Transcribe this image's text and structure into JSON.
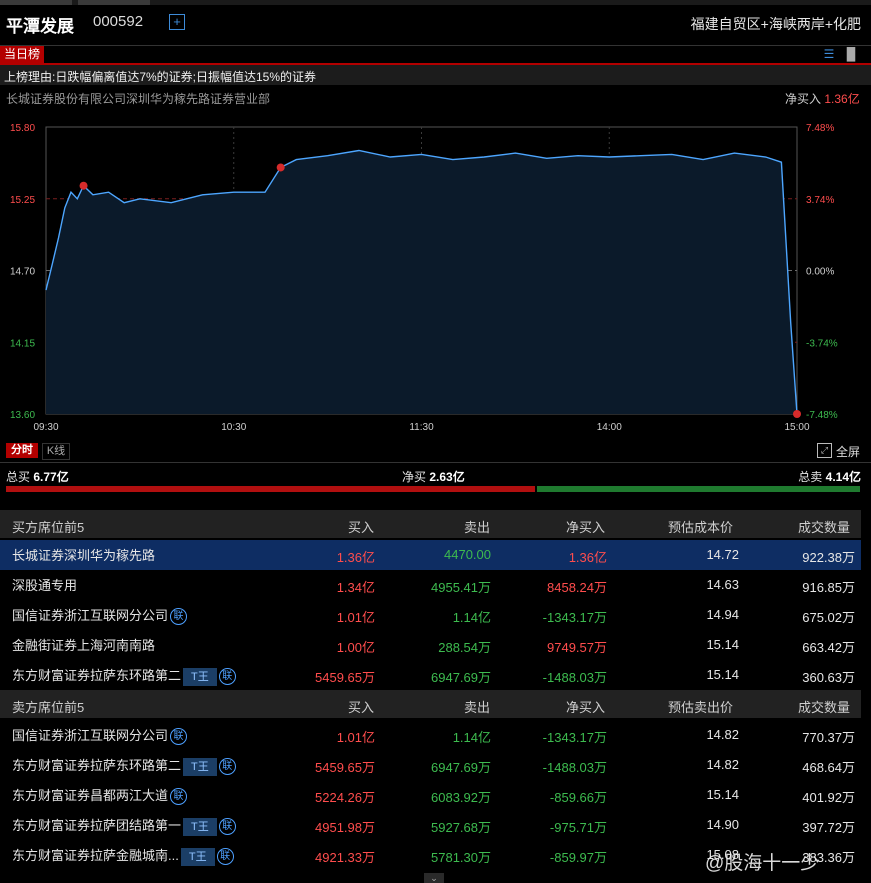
{
  "header": {
    "stock_name": "平潭发展",
    "stock_code": "000592",
    "add_symbol": "+",
    "concepts": "福建自贸区+海峡两岸+化肥"
  },
  "board": {
    "badge": "当日榜",
    "list_icon": "list-icon",
    "bar_icon": "bar-chart-icon",
    "reason": "上榜理由:日跌幅偏离值达7%的证券;日振幅值达15%的证券",
    "broker": "长城证券股份有限公司深圳华为稼先路证券营业部",
    "netbuy_label": "净买入",
    "netbuy_value": "1.36亿"
  },
  "chart_data": {
    "type": "line",
    "title": "",
    "x_ticks": [
      "09:30",
      "10:30",
      "11:30",
      "14:00",
      "15:00"
    ],
    "y_left_ticks": [
      "15.80",
      "15.25",
      "14.70",
      "14.15",
      "13.60"
    ],
    "y_right_ticks": [
      "7.48%",
      "3.74%",
      "0.00%",
      "-3.74%",
      "-7.48%"
    ],
    "ylim": [
      13.6,
      15.8
    ],
    "prev_close": 14.7,
    "series": [
      {
        "x_index": [
          0,
          2,
          4,
          6,
          8,
          10,
          12,
          15,
          20,
          25,
          30,
          40,
          50,
          60,
          70,
          75,
          80,
          90,
          100,
          110,
          120,
          130,
          140,
          150,
          160,
          170,
          180,
          190,
          200,
          210,
          220,
          230,
          235,
          238,
          240
        ],
        "values": [
          14.55,
          14.75,
          14.95,
          15.18,
          15.3,
          15.25,
          15.35,
          15.28,
          15.3,
          15.22,
          15.25,
          15.22,
          15.28,
          15.3,
          15.3,
          15.49,
          15.55,
          15.58,
          15.62,
          15.57,
          15.59,
          15.55,
          15.57,
          15.6,
          15.56,
          15.58,
          15.57,
          15.58,
          15.59,
          15.55,
          15.6,
          15.57,
          15.53,
          14.3,
          13.6
        ]
      }
    ],
    "markers_x_index": [
      12,
      75,
      240
    ],
    "colors": {
      "line": "#4da6ff",
      "fill": "#0b1a2a",
      "marker": "#d62b2b"
    }
  },
  "chart_tabs": {
    "fenshi": "分时",
    "kline": "K线",
    "fullscreen": "全屏",
    "fullscreen_icon": "fullscreen-icon"
  },
  "totals": {
    "buy_label": "总买",
    "buy_value": "6.77亿",
    "net_label": "净买",
    "net_value": "2.63亿",
    "sell_label": "总卖",
    "sell_value": "4.14亿",
    "buy_fraction": 0.62
  },
  "buy_table": {
    "headers": [
      "买方席位前5",
      "买入",
      "卖出",
      "净买入",
      "预估成本价",
      "成交数量"
    ],
    "rows": [
      {
        "name": "长城证券深圳华为稼先路",
        "buy": "1.36亿",
        "sell": "4470.00",
        "net": "1.36亿",
        "price": "14.72",
        "vol": "922.38万",
        "tbadge": "",
        "lian": "",
        "net_color": "red"
      },
      {
        "name": "深股通专用",
        "buy": "1.34亿",
        "sell": "4955.41万",
        "net": "8458.24万",
        "price": "14.63",
        "vol": "916.85万",
        "tbadge": "",
        "lian": "",
        "net_color": "red"
      },
      {
        "name": "国信证券浙江互联网分公司",
        "buy": "1.01亿",
        "sell": "1.14亿",
        "net": "-1343.17万",
        "price": "14.94",
        "vol": "675.02万",
        "tbadge": "",
        "lian": "联",
        "net_color": "green"
      },
      {
        "name": "金融街证券上海河南南路",
        "buy": "1.00亿",
        "sell": "288.54万",
        "net": "9749.57万",
        "price": "15.14",
        "vol": "663.42万",
        "tbadge": "",
        "lian": "",
        "net_color": "red"
      },
      {
        "name": "东方财富证券拉萨东环路第二",
        "buy": "5459.65万",
        "sell": "6947.69万",
        "net": "-1488.03万",
        "price": "15.14",
        "vol": "360.63万",
        "tbadge": "T王",
        "lian": "联",
        "net_color": "green"
      }
    ]
  },
  "sell_table": {
    "headers": [
      "卖方席位前5",
      "买入",
      "卖出",
      "净买入",
      "预估卖出价",
      "成交数量"
    ],
    "rows": [
      {
        "name": "国信证券浙江互联网分公司",
        "buy": "1.01亿",
        "sell": "1.14亿",
        "net": "-1343.17万",
        "price": "14.82",
        "vol": "770.37万",
        "tbadge": "",
        "lian": "联",
        "net_color": "green"
      },
      {
        "name": "东方财富证券拉萨东环路第二",
        "buy": "5459.65万",
        "sell": "6947.69万",
        "net": "-1488.03万",
        "price": "14.82",
        "vol": "468.64万",
        "tbadge": "T王",
        "lian": "联",
        "net_color": "green"
      },
      {
        "name": "东方财富证券昌都两江大道",
        "buy": "5224.26万",
        "sell": "6083.92万",
        "net": "-859.66万",
        "price": "15.14",
        "vol": "401.92万",
        "tbadge": "",
        "lian": "联",
        "net_color": "green"
      },
      {
        "name": "东方财富证券拉萨团结路第一",
        "buy": "4951.98万",
        "sell": "5927.68万",
        "net": "-975.71万",
        "price": "14.90",
        "vol": "397.72万",
        "tbadge": "T王",
        "lian": "联",
        "net_color": "green"
      },
      {
        "name": "东方财富证券拉萨金融城南...",
        "buy": "4921.33万",
        "sell": "5781.30万",
        "net": "-859.97万",
        "price": "15.08",
        "vol": "383.36万",
        "tbadge": "T王",
        "lian": "联",
        "net_color": "green"
      }
    ]
  },
  "watermark": "@股海十一少",
  "scroll_down": "⌄"
}
